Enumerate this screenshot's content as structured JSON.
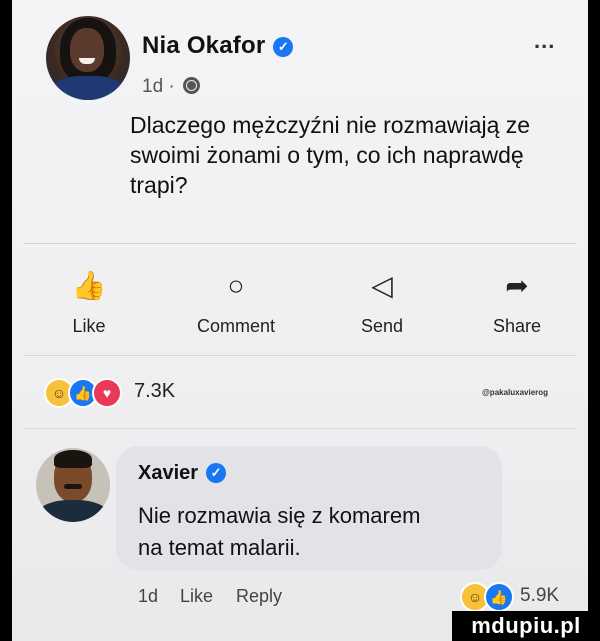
{
  "post": {
    "author_name": "Nia Okafor",
    "verified_icon": "verified-badge-icon",
    "time": "1d ·",
    "audience_icon": "globe-icon",
    "more_label": "...",
    "text": "Dlaczego mężczyźni nie rozmawiają ze swoimi żonami o tym, co ich naprawdę trapi?"
  },
  "actions": [
    {
      "label": "Like",
      "icon": "like-icon",
      "glyph": "👍"
    },
    {
      "label": "Comment",
      "icon": "comment-icon",
      "glyph": "○"
    },
    {
      "label": "Send",
      "icon": "send-icon",
      "glyph": "◁"
    },
    {
      "label": "Share",
      "icon": "share-icon",
      "glyph": "➦"
    }
  ],
  "reactions": {
    "types": [
      "haha",
      "like",
      "love"
    ],
    "count": "7.3K",
    "watermark": "@pakaluxavierog"
  },
  "comment": {
    "author": "Xavier",
    "text_line1": "Nie rozmawia się z komarem",
    "text_line2": "na temat malarii.",
    "time": "1d",
    "like_label": "Like",
    "reply_label": "Reply",
    "reaction_count": "5.9K"
  },
  "brand": "mdupiu.pl",
  "colors": {
    "accent": "#1877f2",
    "love": "#e83a56",
    "haha": "#f7c23a"
  }
}
